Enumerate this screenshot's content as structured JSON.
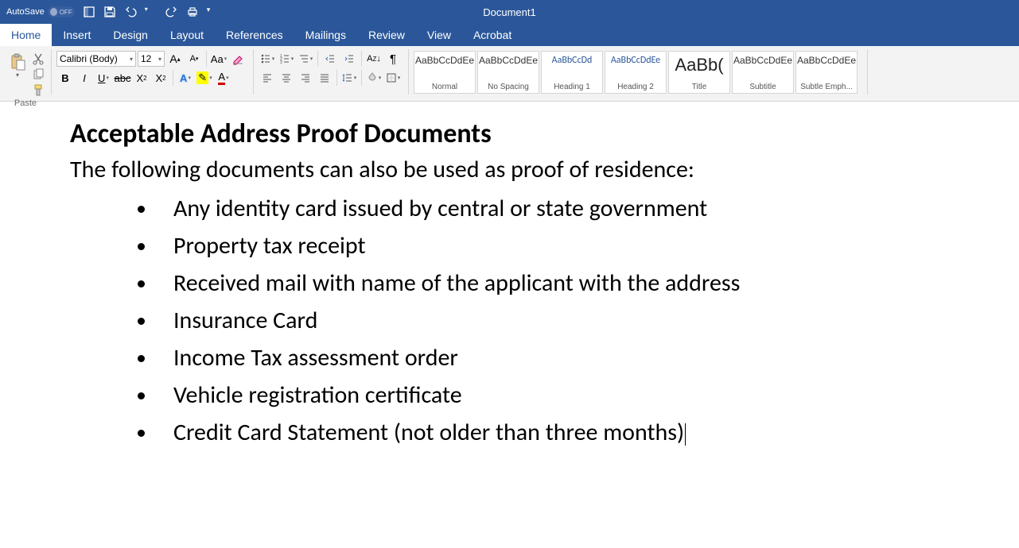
{
  "titlebar": {
    "autosave_label": "AutoSave",
    "autosave_state": "OFF",
    "doc_title": "Document1"
  },
  "tabs": [
    "Home",
    "Insert",
    "Design",
    "Layout",
    "References",
    "Mailings",
    "Review",
    "View",
    "Acrobat"
  ],
  "active_tab": "Home",
  "ribbon": {
    "paste_label": "Paste",
    "font_name": "Calibri (Body)",
    "font_size": "12",
    "styles": [
      {
        "sample": "AaBbCcDdEe",
        "label": "Normal",
        "class": ""
      },
      {
        "sample": "AaBbCcDdEe",
        "label": "No Spacing",
        "class": ""
      },
      {
        "sample": "AaBbCcDd",
        "label": "Heading 1",
        "class": "blue"
      },
      {
        "sample": "AaBbCcDdEe",
        "label": "Heading 2",
        "class": "blue"
      },
      {
        "sample": "AaBb(",
        "label": "Title",
        "class": "big"
      },
      {
        "sample": "AaBbCcDdEe",
        "label": "Subtitle",
        "class": ""
      },
      {
        "sample": "AaBbCcDdEe",
        "label": "Subtle Emph...",
        "class": ""
      }
    ]
  },
  "document": {
    "heading": "Acceptable Address Proof Documents",
    "intro": "The following documents can also be used as proof of residence:",
    "bullets": [
      "Any identity card issued by central or state government",
      "Property tax receipt",
      "Received mail with name of the applicant with the address",
      "Insurance Card",
      "Income Tax assessment order",
      "Vehicle registration certificate",
      "Credit Card Statement (not older than three months)"
    ]
  }
}
